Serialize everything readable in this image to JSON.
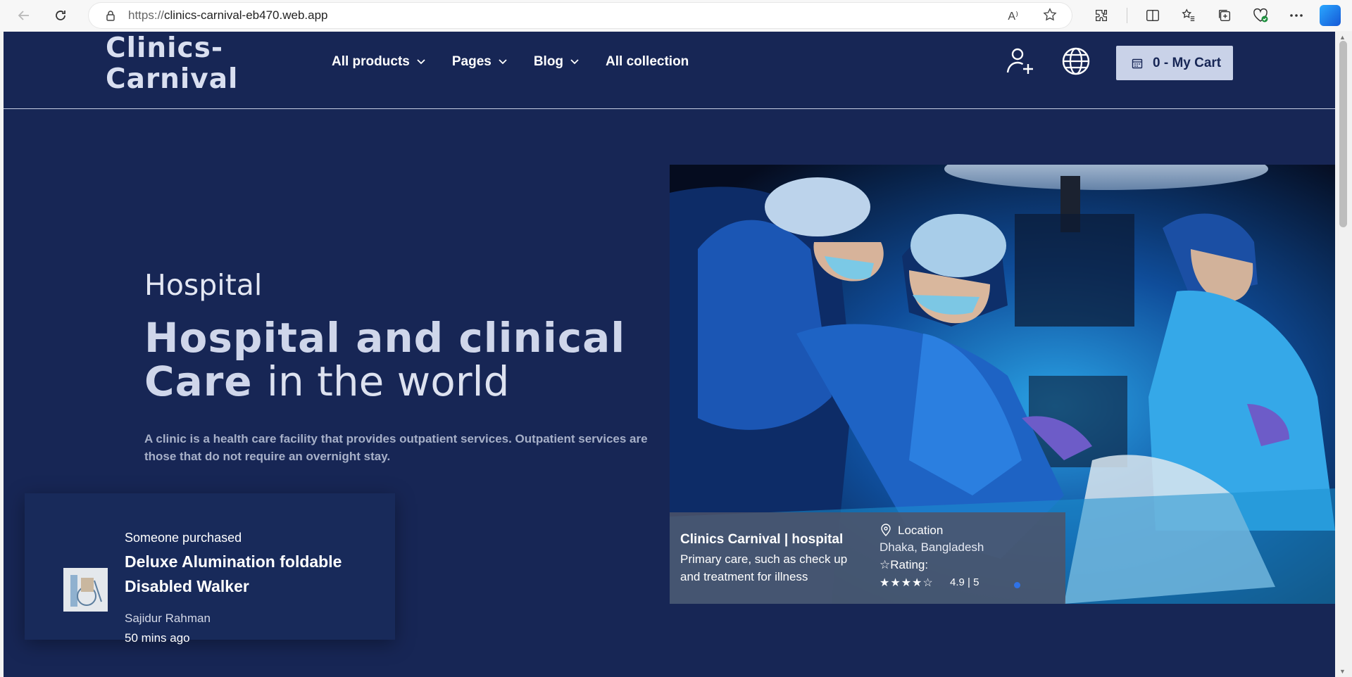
{
  "browser": {
    "url_protocol": "https://",
    "url_host": "clinics-carnival-eb470.web.app",
    "read_aloud_label": "A⁾"
  },
  "header": {
    "logo_line1": "Clinics-",
    "logo_line2": "Carnival",
    "menu": [
      {
        "label": "All products",
        "has_dropdown": true
      },
      {
        "label": "Pages",
        "has_dropdown": true
      },
      {
        "label": "Blog",
        "has_dropdown": true
      },
      {
        "label": "All collection",
        "has_dropdown": false
      }
    ],
    "cart_label": "0 - My Cart"
  },
  "hero": {
    "eyebrow": "Hospital",
    "title_bold_line1": "Hospital and clinical",
    "title_bold_line2": "Care",
    "title_thin": "in the world",
    "description": "A clinic is a health care facility that provides outpatient services. Outpatient services are those that do not require an overnight stay."
  },
  "slide_caption": {
    "title": "Clinics Carnival | hospital",
    "description": "Primary care, such as check up and treatment for illness",
    "location_label": "Location",
    "location_value": "Dhaka, Bangladesh",
    "rating_label": "☆Rating:",
    "stars": "★★★★☆",
    "score": "4.9 | 5",
    "rating_value": 4.9,
    "rating_max": 5
  },
  "purchase_toast": {
    "label": "Someone purchased",
    "product": "Deluxe Alumination foldable Disabled Walker",
    "buyer": "Sajidur Rahman",
    "time_ago": "50 mins ago"
  },
  "colors": {
    "page_bg": "#172655",
    "cart_bg": "#c9d2e8",
    "accent_dot": "#2f72e6"
  }
}
